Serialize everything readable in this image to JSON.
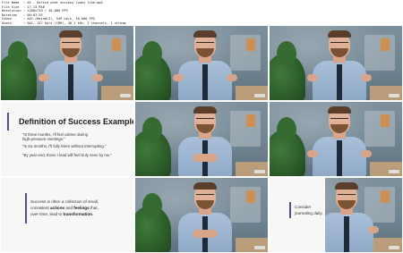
{
  "info": {
    "rows": [
      {
        "key": "File Name",
        "value": ": 02 - Define what success looks like.mp4"
      },
      {
        "key": "File Size",
        "value": ": 17.13 MiB"
      },
      {
        "key": "Resolution",
        "value": ": 1280x720 / 30.000 FPS"
      },
      {
        "key": "Duration",
        "value": ": 00:03:35"
      },
      {
        "key": "Video",
        "value": ": AVC (Main@L3), 549 kb/s, 30.000 FPS"
      },
      {
        "key": "Audio",
        "value": ": AAC, 157 kb/s (CBR), 48.1 kHz, 2 channels, 1 stream"
      }
    ]
  },
  "slides": {
    "definition": {
      "title": "Definition of Success Example",
      "quotes": [
        "\"In three months, I'll feel calmer during",
        "high-pressure meetings.\"",
        "\"In six months, I'll fully listen without interrupting.\"",
        "\"By year-end, those I lead will feel truly seen by me.\""
      ]
    },
    "transformation": {
      "line1": "Success is often a collection of small,",
      "line2_pre": "consistent ",
      "line2_b1": "actions",
      "line2_mid": " and ",
      "line2_b2": "feelings",
      "line2_post": " that,",
      "line3_pre": "over time, lead to ",
      "line3_b": "transformation",
      "line3_post": "."
    },
    "journaling": {
      "line1": "Consider",
      "line2": "journaling daily."
    }
  }
}
